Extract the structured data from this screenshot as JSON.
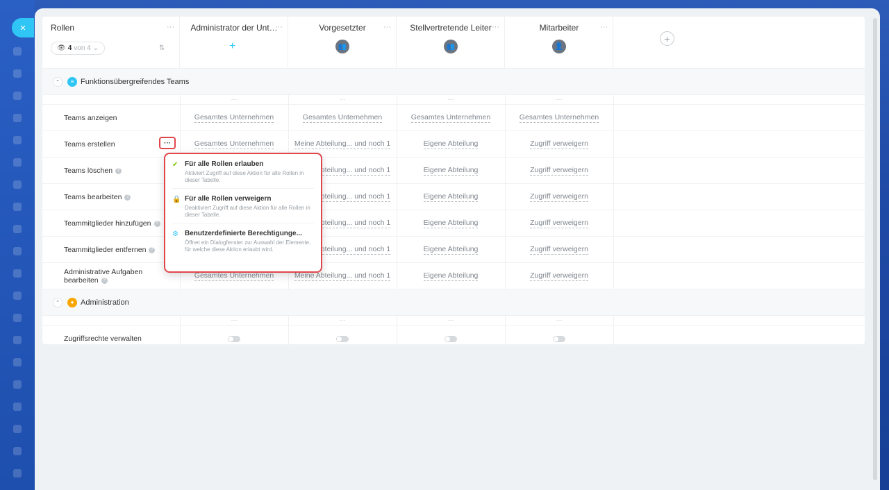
{
  "close_icon": "×",
  "header": {
    "roles_title": "Rollen",
    "counter_value": "4",
    "counter_suffix": "von 4",
    "more_dots": "···",
    "roles": [
      {
        "name": "Administrator der Unt…",
        "icon": "plus-icon"
      },
      {
        "name": "Vorgesetzter",
        "icon": "group-icon"
      },
      {
        "name": "Stellvertretende Leiter",
        "icon": "group-icon"
      },
      {
        "name": "Mitarbeiter",
        "icon": "user-icon"
      }
    ],
    "add_role": "+"
  },
  "groups": [
    {
      "title": "Funktionsübergreifendes Teams",
      "color": "#2fc6f6",
      "icon_char": "≡"
    },
    {
      "title": "Administration",
      "color": "#f7a700",
      "icon_char": "●"
    }
  ],
  "permissions": [
    {
      "label": "Teams anzeigen",
      "help": false,
      "values": [
        "Gesamtes Unternehmen",
        "Gesamtes Unternehmen",
        "Gesamtes Unternehmen",
        "Gesamtes Unternehmen"
      ]
    },
    {
      "label": "Teams erstellen",
      "help": false,
      "values": [
        "Gesamtes Unternehmen",
        "Meine Abteilung... und noch 1",
        "Eigene Abteilung",
        "Zugriff verweigern"
      ]
    },
    {
      "label": "Teams löschen",
      "help": true,
      "values": [
        "",
        "Meine Abteilung... und noch 1",
        "Eigene Abteilung",
        "Zugriff verweigern"
      ]
    },
    {
      "label": "Teams bearbeiten",
      "help": true,
      "values": [
        "",
        "Meine Abteilung... und noch 1",
        "Eigene Abteilung",
        "Zugriff verweigern"
      ]
    },
    {
      "label": "Teammitglieder hinzufügen",
      "help": true,
      "values": [
        "",
        "Meine Abteilung... und noch 1",
        "Eigene Abteilung",
        "Zugriff verweigern"
      ]
    },
    {
      "label": "Teammitglieder entfernen",
      "help": true,
      "values": [
        "",
        "Meine Abteilung... und noch 1",
        "Eigene Abteilung",
        "Zugriff verweigern"
      ]
    },
    {
      "label": "Administrative Aufgaben bearbeiten",
      "help": true,
      "values": [
        "Gesamtes Unternehmen",
        "Meine Abteilung... und noch 1",
        "Eigene Abteilung",
        "Zugriff verweigern"
      ]
    }
  ],
  "admin_permissions": [
    {
      "label": "Zugriffsrechte verwalten"
    }
  ],
  "row_menu": "···",
  "popup": {
    "items": [
      {
        "title": "Für alle Rollen erlauben",
        "desc": "Aktiviert Zugriff auf diese Aktion für alle Rollen in dieser Tabelle.",
        "icon": "✔",
        "icon_color": "#7bc400"
      },
      {
        "title": "Für alle Rollen verweigern",
        "desc": "Deaktiviert Zugriff auf diese Aktion für alle Rollen in dieser Tabelle.",
        "icon": "🔒",
        "icon_color": "#e0474c"
      },
      {
        "title": "Benutzerdefinierte Berechtigunge...",
        "desc": "Öffnet ein Dialogfenster zur Auswahl der Elemente, für welche diese Aktion erlaubt wird.",
        "icon": "⚙",
        "icon_color": "#2fc6f6"
      }
    ]
  }
}
